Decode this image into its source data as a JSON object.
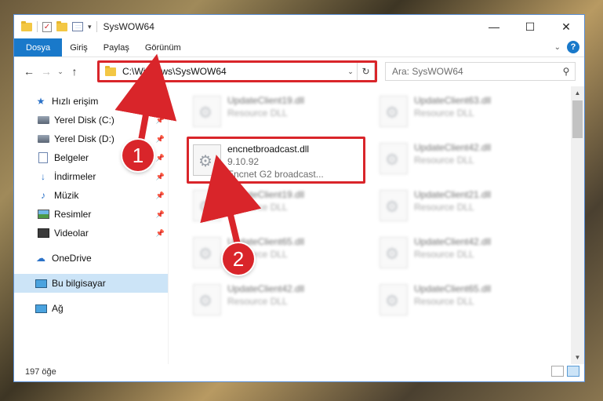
{
  "window": {
    "title": "SysWOW64",
    "controls": {
      "minimize": "—",
      "maximize": "☐",
      "close": "✕"
    }
  },
  "quick_access_toolbar": {
    "dropdown": "▾",
    "check": "✓"
  },
  "ribbon": {
    "tabs": [
      {
        "label": "Dosya"
      },
      {
        "label": "Giriş"
      },
      {
        "label": "Paylaş"
      },
      {
        "label": "Görünüm"
      }
    ],
    "expand_glyph": "⌄",
    "help_glyph": "?"
  },
  "nav": {
    "back": "←",
    "forward": "→",
    "recent": "⌄",
    "up": "↑",
    "address": "C:\\Windows\\SysWOW64",
    "address_dropdown": "⌄",
    "refresh": "↻",
    "search_placeholder": "Ara: SysWOW64",
    "search_icon": "⚲"
  },
  "sidebar": {
    "quick_access": "Hızlı erişim",
    "items": [
      {
        "label": "Yerel Disk (C:)",
        "icon": "disk-icon"
      },
      {
        "label": "Yerel Disk (D:)",
        "icon": "disk-icon"
      },
      {
        "label": "Belgeler",
        "icon": "documents-icon"
      },
      {
        "label": "İndirmeler",
        "icon": "downloads-icon"
      },
      {
        "label": "Müzik",
        "icon": "music-icon"
      },
      {
        "label": "Resimler",
        "icon": "pictures-icon"
      },
      {
        "label": "Videolar",
        "icon": "videos-icon"
      }
    ],
    "pin_glyph": "📌",
    "onedrive": "OneDrive",
    "this_pc": "Bu bilgisayar",
    "network": "Ağ"
  },
  "files": {
    "highlighted": {
      "name": "encnetbroadcast.dll",
      "version": "9.10.92",
      "description": "Encnet G2 broadcast..."
    },
    "left_column": [
      {
        "name": "UpdateClient19.dll",
        "sub": "Resource DLL"
      },
      {
        "name": "UpdateClient19.dll",
        "sub": "Resource DLL"
      },
      {
        "name": "UpdateClient65.dll",
        "sub": "Resource DLL"
      },
      {
        "name": "UpdateClient42.dll",
        "sub": "Resource DLL"
      }
    ],
    "right_column": [
      {
        "name": "UpdateClient63.dll",
        "sub": "Resource DLL"
      },
      {
        "name": "UpdateClient42.dll",
        "sub": "Resource DLL"
      },
      {
        "name": "UpdateClient21.dll",
        "sub": "Resource DLL"
      },
      {
        "name": "UpdateClient42.dll",
        "sub": "Resource DLL"
      },
      {
        "name": "UpdateClient65.dll",
        "sub": "Resource DLL"
      }
    ]
  },
  "scrollbar": {
    "up": "▲",
    "down": "▼"
  },
  "status": {
    "item_count": "197 öğe"
  },
  "callouts": {
    "one": "1",
    "two": "2"
  },
  "colors": {
    "accent": "#1979ca",
    "highlight": "#d9252a",
    "selection": "#cce4f7"
  }
}
